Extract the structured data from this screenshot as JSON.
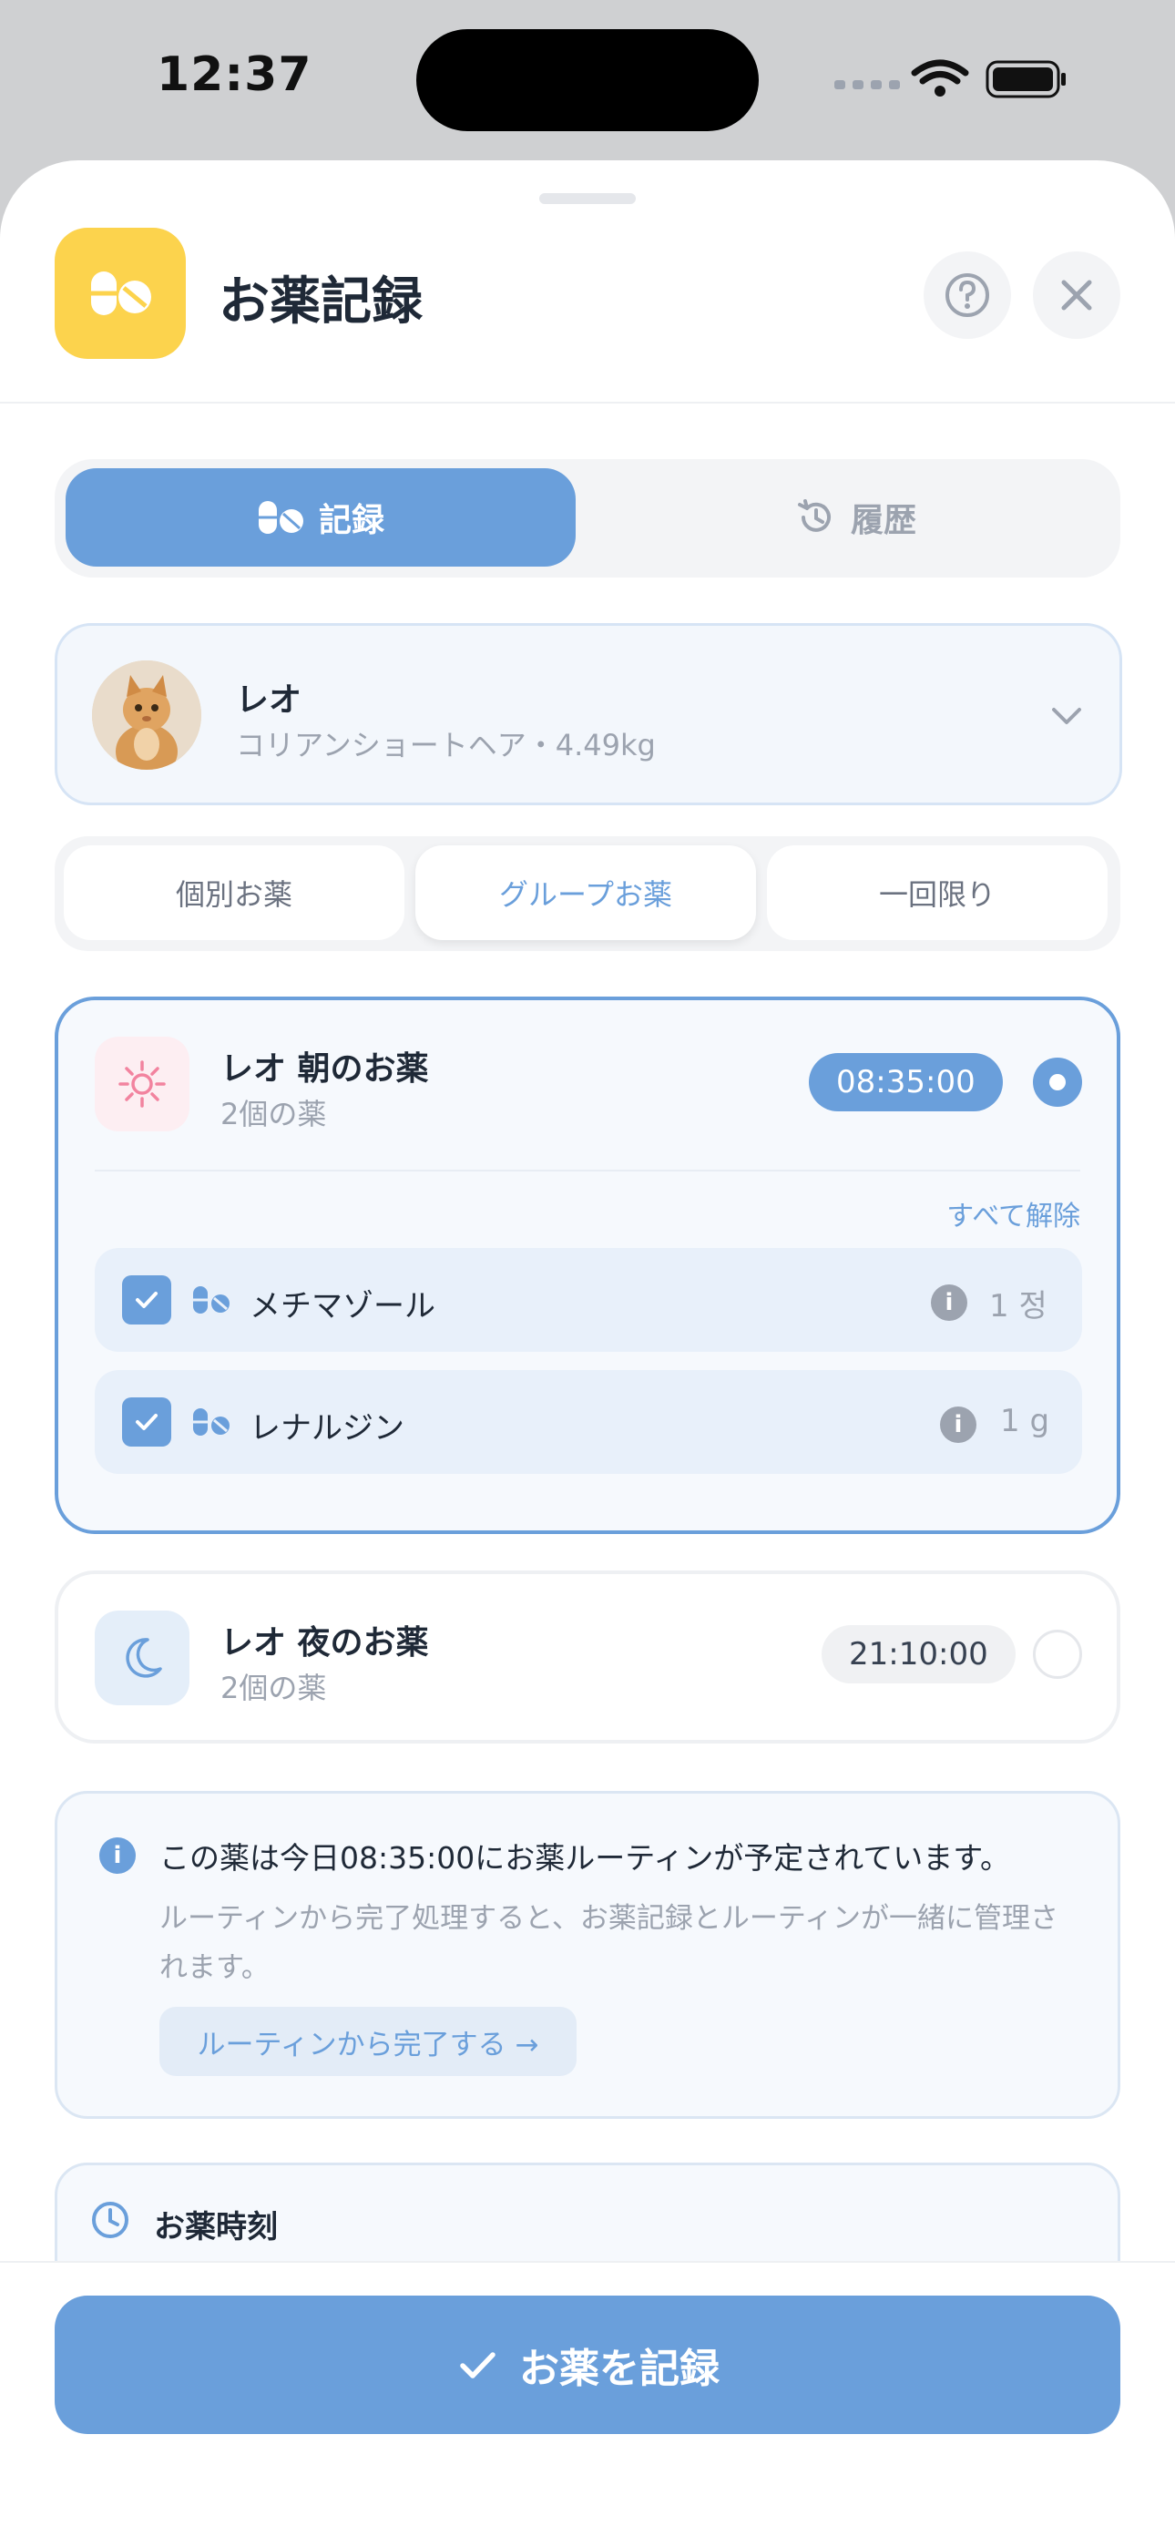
{
  "status": {
    "time": "12:37"
  },
  "header": {
    "title": "お薬記録"
  },
  "segment": {
    "record": "記録",
    "history": "履歴"
  },
  "pet": {
    "name": "レオ",
    "detail": "コリアンショートヘア・4.49kg"
  },
  "tabs": [
    "個別お薬",
    "グループお薬",
    "一回限り"
  ],
  "groups": [
    {
      "name": "レオ 朝のお薬",
      "count": "2個の薬",
      "time": "08:35:00",
      "selected": true,
      "deselect_all": "すべて解除",
      "meds": [
        {
          "name": "メチマゾール",
          "dose": "1 정",
          "checked": true
        },
        {
          "name": "レナルジン",
          "dose": "1 g",
          "checked": true
        }
      ]
    },
    {
      "name": "レオ 夜のお薬",
      "count": "2個の薬",
      "time": "21:10:00",
      "selected": false
    }
  ],
  "notice": {
    "main": "この薬は今日08:35:00にお薬ルーティンが予定されています。",
    "sub": "ルーティンから完了処理すると、お薬記録とルーティンが一緒に管理されます。",
    "button": "ルーティンから完了する →"
  },
  "med_time": {
    "label": "お薬時刻"
  },
  "footer": {
    "record_button": "お薬を記録"
  },
  "colors": {
    "accent": "#6a9fdb",
    "app_icon": "#fcd34d"
  }
}
